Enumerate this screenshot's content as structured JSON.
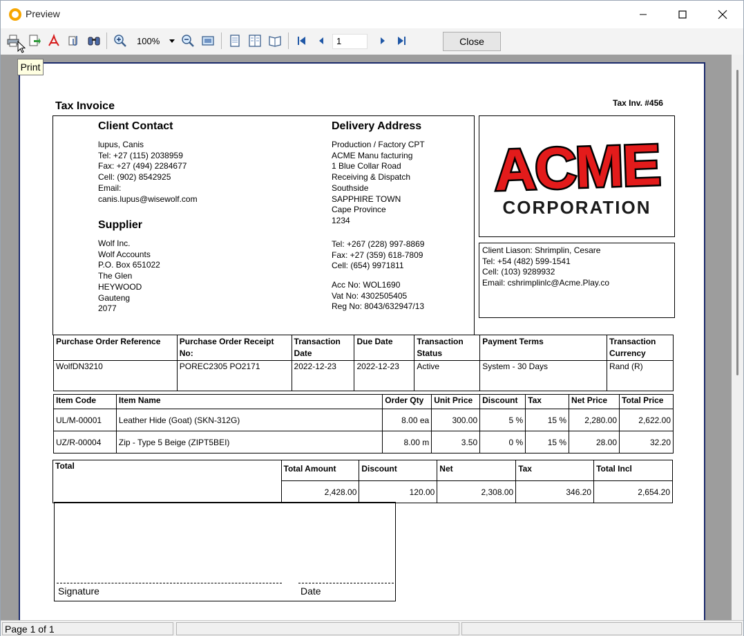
{
  "window": {
    "title": "Preview"
  },
  "toolbar": {
    "zoom": "100%",
    "page_number": "1",
    "close_label": "Close",
    "tooltip": "Print",
    "icons": [
      "print-icon",
      "export-icon",
      "pdf-icon",
      "attach-icon",
      "find-icon",
      "zoom-in-icon",
      "zoom-out-icon",
      "fit-page-icon",
      "single-page-icon",
      "multi-page-icon",
      "book-icon",
      "first-page-icon",
      "prev-page-icon",
      "next-page-icon",
      "last-page-icon"
    ]
  },
  "status": {
    "page_label": "Page 1 of 1"
  },
  "invoice": {
    "title": "Tax Invoice",
    "number": "Tax Inv. #456",
    "client": {
      "heading": "Client Contact",
      "lines": [
        "lupus, Canis",
        "Tel: +27 (115) 2038959",
        "Fax: +27 (494) 2284677",
        "Cell: (902) 8542925",
        "Email:",
        "canis.lupus@wisewolf.com"
      ]
    },
    "supplier": {
      "heading": "Supplier",
      "lines": [
        "Wolf Inc.",
        "Wolf Accounts",
        "P.O. Box 651022",
        "The Glen",
        "HEYWOOD",
        "Gauteng",
        "2077"
      ]
    },
    "delivery": {
      "heading": "Delivery Address",
      "lines": [
        "Production / Factory CPT",
        "ACME Manu facturing",
        "1 Blue Collar Road",
        "Receiving & Dispatch",
        "Southside",
        "SAPPHIRE TOWN",
        "Cape Province",
        "1234"
      ],
      "contact_lines": [
        "Tel: +267 (228) 997-8869",
        "Fax: +27 (359) 618-7809",
        "Cell: (654) 9971811"
      ],
      "reg_lines": [
        "Acc No: WOL1690",
        "Vat No: 4302505405",
        "Reg No: 8043/632947/13"
      ]
    },
    "logo": {
      "top": "ACME",
      "bottom": "CORPORATION",
      "colors": {
        "red": "#e31b1b",
        "outline": "#000000"
      }
    },
    "liaison": {
      "lines": [
        "Client Liason: Shrimplin, Cesare",
        "Tel: +54 (482) 599-1541",
        "Cell: (103) 9289932",
        "Email: cshrimplinlc@Acme.Play.co"
      ]
    },
    "order_headers": [
      "Purchase Order Reference",
      "Purchase Order Receipt No:",
      "Transaction Date",
      "Due Date",
      "Transaction Status",
      "Payment Terms",
      "Transaction Currency"
    ],
    "order_values": [
      "WolfDN3210",
      "POREC2305 PO2171",
      "2022-12-23",
      "2022-12-23",
      "Active",
      "System - 30 Days",
      "Rand (R)"
    ],
    "item_headers": [
      "Item Code",
      "Item Name",
      "Order Qty",
      "Unit Price",
      "Discount",
      "Tax",
      "Net Price",
      "Total Price"
    ],
    "items": [
      [
        "UL/M-00001",
        "Leather Hide (Goat) (SKN-312G)",
        "8.00 ea",
        "300.00",
        "5 %",
        "15 %",
        "2,280.00",
        "2,622.00"
      ],
      [
        "UZ/R-00004",
        "Zip - Type 5 Beige (ZIPT5BEI)",
        "8.00 m",
        "3.50",
        "0 %",
        "15 %",
        "28.00",
        "32.20"
      ]
    ],
    "totals": {
      "label": "Total",
      "headers": [
        "Total Amount",
        "Discount",
        "Net",
        "Tax",
        "Total Incl"
      ],
      "values": [
        "2,428.00",
        "120.00",
        "2,308.00",
        "346.20",
        "2,654.20"
      ]
    },
    "signature": {
      "sig_label": "Signature",
      "date_label": "Date"
    }
  }
}
